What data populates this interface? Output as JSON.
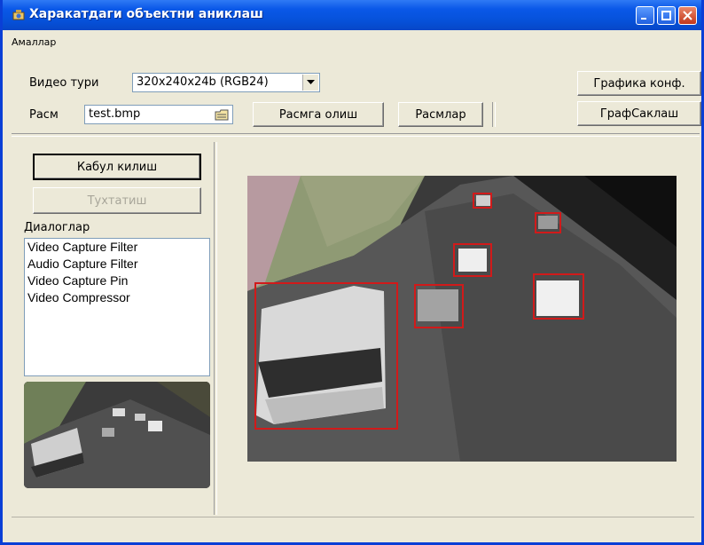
{
  "window": {
    "title": "Харакатдаги объектни аниклаш"
  },
  "menu": {
    "items": [
      "Амаллар"
    ]
  },
  "controls": {
    "video_type_label": "Видео тури",
    "video_type_value": "320x240x24b (RGB24)",
    "image_label": "Расм",
    "image_value": "test.bmp",
    "capture_image_button": "Расмга олиш",
    "images_button": "Расмлар",
    "graph_config_button": "Графика конф.",
    "graph_save_button": "ГрафСаклаш",
    "accept_button": "Кабул килиш",
    "stop_button": "Тухтатиш",
    "dialogs_label": "Диалоглар"
  },
  "dialogs": [
    "Video Capture Filter",
    "Audio Capture Filter",
    "Video Capture Pin",
    "Video Compressor"
  ],
  "colors": {
    "titlebar": "#0651d9",
    "window_bg": "#ece9d8",
    "bbox": "#d11a1a"
  },
  "icons": {
    "title": "app-icon",
    "minimize": "minimize-icon",
    "maximize": "maximize-icon",
    "close": "close-icon",
    "browse": "folder-icon",
    "dropdown": "chevron-down-icon"
  }
}
